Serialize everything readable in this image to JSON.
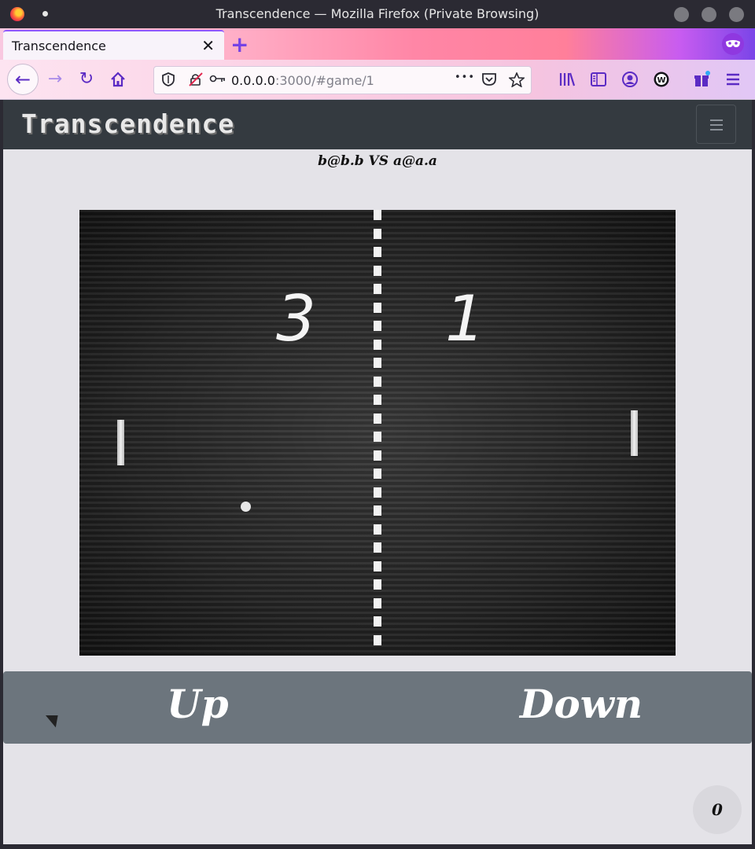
{
  "window": {
    "title": "Transcendence — Mozilla Firefox (Private Browsing)"
  },
  "tab": {
    "label": "Transcendence",
    "close": "✕",
    "new_tab": "+"
  },
  "urlbar": {
    "host": "0.0.0.0",
    "path": ":3000/#game/1",
    "more": "•••"
  },
  "app": {
    "brand": "Transcendence",
    "matchup": "b@b.b VS a@a.a"
  },
  "game": {
    "left_score": "3",
    "right_score": "1"
  },
  "controls": {
    "up_label": "Up",
    "down_label": "Down"
  },
  "fab": {
    "count": "0"
  },
  "colors": {
    "navbar": "#343a40",
    "controls": "#6c757d",
    "page_bg": "#e4e3e8",
    "accent": "#7542e5"
  }
}
